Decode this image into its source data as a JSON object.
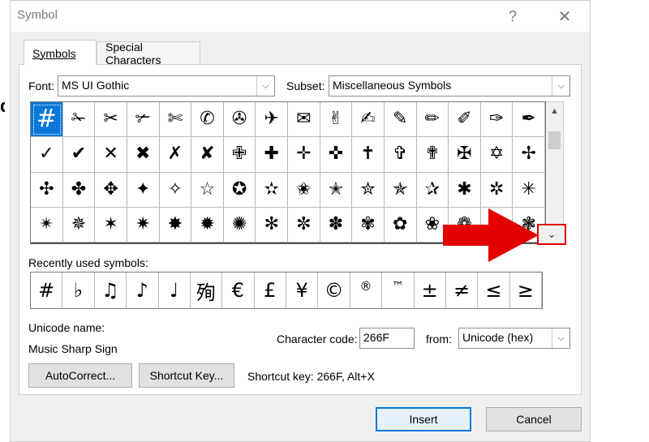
{
  "dialog": {
    "title": "Symbol",
    "help": "?",
    "close": "✕"
  },
  "tabs": [
    {
      "label": "Symbols",
      "active": true
    },
    {
      "label": "Special Characters",
      "active": false
    }
  ],
  "font": {
    "label": "Font:",
    "value": "MS UI Gothic"
  },
  "subset": {
    "label": "Subset:",
    "value": "Miscellaneous Symbols"
  },
  "symbol_grid": [
    "#",
    "✁",
    "✂",
    "✃",
    "✄",
    "✆",
    "✇",
    "✈",
    "✉",
    "✌",
    "✍",
    "✎",
    "✏",
    "✐",
    "✑",
    "✒",
    "✓",
    "✔",
    "✕",
    "✖",
    "✗",
    "✘",
    "✙",
    "✚",
    "✛",
    "✜",
    "✝",
    "✞",
    "✟",
    "✠",
    "✡",
    "✢",
    "✣",
    "✤",
    "✥",
    "✦",
    "✧",
    "☆",
    "✪",
    "✫",
    "✬",
    "✭",
    "✮",
    "✯",
    "✰",
    "✱",
    "✲",
    "✳",
    "✴",
    "✵",
    "✶",
    "✷",
    "✸",
    "✹",
    "✺",
    "✻",
    "✼",
    "✽",
    "✾",
    "✿",
    "❀",
    "❁",
    "❂",
    "❃"
  ],
  "selected_symbol_index": 0,
  "recent": {
    "label": "Recently used symbols:",
    "symbols": [
      "#",
      "♭",
      "♫",
      "♪",
      "♩",
      "殉",
      "€",
      "£",
      "¥",
      "©",
      "®",
      "™",
      "±",
      "≠",
      "≤",
      "≥"
    ]
  },
  "unicode_name": {
    "label": "Unicode name:",
    "value": "Music Sharp Sign"
  },
  "character_code": {
    "label": "Character code:",
    "value": "266F"
  },
  "from": {
    "label": "from:",
    "value": "Unicode (hex)"
  },
  "buttons": {
    "autocorrect": "AutoCorrect...",
    "shortcut_key": "Shortcut Key...",
    "insert": "Insert",
    "cancel": "Cancel"
  },
  "shortcut_text": "Shortcut key: 266F, Alt+X",
  "icons": {
    "scroll_up": "chevron-up-icon",
    "scroll_down": "chevron-down-icon",
    "dropdown": "chevron-down-icon",
    "annotation": "red-arrow-icon"
  },
  "colors": {
    "selection": "#0a78d7",
    "annotation": "#e30000"
  }
}
